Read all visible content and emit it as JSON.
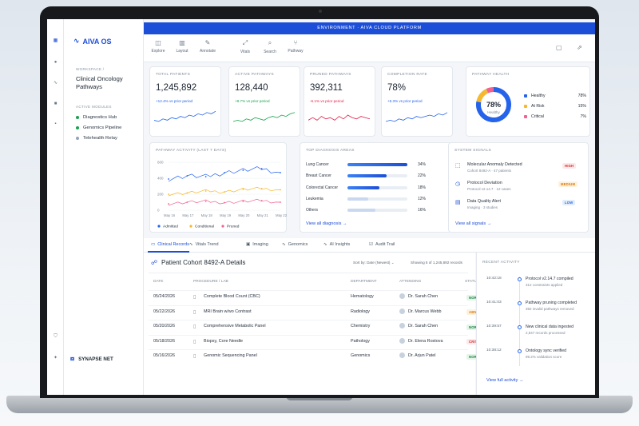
{
  "header": {
    "env": "ENVIRONMENT · AIVA CLOUD PLATFORM"
  },
  "brand": {
    "name": "AIVA OS"
  },
  "workspace": {
    "label": "WORKSPACE /",
    "name": "Clinical Oncology Pathways"
  },
  "modules": {
    "label": "ACTIVE MODULES",
    "items": [
      {
        "label": "Diagnostics Hub",
        "color": "#16a34a"
      },
      {
        "label": "Genomics Pipeline",
        "color": "#16a34a"
      },
      {
        "label": "Telehealth Relay",
        "color": "#94a3b8"
      }
    ]
  },
  "footer_brand": "SYNAPSE NET",
  "toolbar": [
    {
      "label": "Explore",
      "icon": "explore-icon",
      "glyph": "◫"
    },
    {
      "label": "Layout",
      "icon": "layout-icon",
      "glyph": "▥"
    },
    {
      "label": "Annotate",
      "icon": "annotate-icon",
      "glyph": "✎"
    },
    {
      "label": "Vitals",
      "icon": "vitals-icon",
      "glyph": "⤢"
    },
    {
      "label": "Search",
      "icon": "search-icon",
      "glyph": "⌕"
    },
    {
      "label": "Pathway",
      "icon": "pathway-icon",
      "glyph": "⑂"
    }
  ],
  "kpis": [
    {
      "title": "TOTAL PATIENTS",
      "value": "1,245,892",
      "delta": "+12.4% vs prior period",
      "color": "#2563eb"
    },
    {
      "title": "ACTIVE PATHWAYS",
      "value": "128,440",
      "delta": "+8.7% vs prior period",
      "color": "#16a34a"
    },
    {
      "title": "PRUNED PATHWAYS",
      "value": "392,311",
      "delta": "-6.1% vs prior period",
      "color": "#e11d48"
    },
    {
      "title": "COMPLETION RATE",
      "value": "78%",
      "delta": "+5.3% vs prior period",
      "color": "#2563eb"
    }
  ],
  "health": {
    "title": "PATHWAY HEALTH",
    "center_value": "78%",
    "center_label": "Healthy",
    "items": [
      {
        "label": "Healthy",
        "value": "78%",
        "pct": 78,
        "color": "#2563eb"
      },
      {
        "label": "At Risk",
        "value": "15%",
        "pct": 15,
        "color": "#f5b82e"
      },
      {
        "label": "Critical",
        "value": "7%",
        "pct": 7,
        "color": "#f06292"
      }
    ]
  },
  "activity": {
    "title": "PATHWAY ACTIVITY (LAST 7 DAYS)",
    "yticks": [
      "600",
      "400",
      "200",
      "0"
    ],
    "xticks": [
      "May 16",
      "May 17",
      "May 18",
      "May 19",
      "May 20",
      "May 21",
      "May 22"
    ],
    "legend": [
      {
        "label": "Admitted",
        "color": "#2563eb"
      },
      {
        "label": "Conditional",
        "color": "#f5b82e"
      },
      {
        "label": "Pruned",
        "color": "#f06292"
      }
    ]
  },
  "chart_data": {
    "type": "line",
    "x": [
      "May 16",
      "May 17",
      "May 18",
      "May 19",
      "May 20",
      "May 21",
      "May 22"
    ],
    "ylim": [
      0,
      600
    ],
    "series": [
      {
        "name": "Admitted",
        "values": [
          390,
          430,
          420,
          470,
          500,
          520,
          470
        ]
      },
      {
        "name": "Conditional",
        "values": [
          200,
          215,
          240,
          230,
          260,
          270,
          255
        ]
      },
      {
        "name": "Pruned",
        "values": [
          80,
          100,
          110,
          95,
          110,
          120,
          100
        ]
      }
    ]
  },
  "diagnosis": {
    "title": "TOP DIAGNOSIS AREAS",
    "items": [
      {
        "label": "Lung Cancer",
        "value": "34%",
        "pct": 34
      },
      {
        "label": "Breast Cancer",
        "value": "22%",
        "pct": 22
      },
      {
        "label": "Colorectal Cancer",
        "value": "18%",
        "pct": 18
      },
      {
        "label": "Leukemia",
        "value": "12%",
        "pct": 12
      },
      {
        "label": "Others",
        "value": "16%",
        "pct": 16
      }
    ],
    "link": "View all diagnosis  →"
  },
  "signals": {
    "title": "SYSTEM SIGNALS",
    "items": [
      {
        "title": "Molecular Anomaly Detected",
        "sub": "Cohort 8492-A · 47 patients",
        "badge": "HIGH",
        "badge_bg": "#fde8ea",
        "badge_fg": "#dc2626",
        "icon": "anomaly-icon",
        "glyph": "⬚"
      },
      {
        "title": "Protocol Deviation",
        "sub": "Protocol v2.14.7 · 12 cases",
        "badge": "MEDIUM",
        "badge_bg": "#fdf1dc",
        "badge_fg": "#d97706",
        "icon": "deviation-icon",
        "glyph": "◷"
      },
      {
        "title": "Data Quality Alert",
        "sub": "Imaging · 3 studies",
        "badge": "LOW",
        "badge_bg": "#e3eefc",
        "badge_fg": "#2563eb",
        "icon": "quality-icon",
        "glyph": "▤"
      }
    ],
    "link": "View all signals  →"
  },
  "tabs": [
    {
      "label": "Clinical Records",
      "icon": "records-icon",
      "glyph": "▭"
    },
    {
      "label": "Vitals Trend",
      "icon": "vitals-trend-icon",
      "glyph": "∿"
    },
    {
      "label": "Imaging",
      "icon": "imaging-icon",
      "glyph": "▣"
    },
    {
      "label": "Genomics",
      "icon": "genomics-icon",
      "glyph": "∿"
    },
    {
      "label": "AI Insights",
      "icon": "ai-icon",
      "glyph": "∿"
    },
    {
      "label": "Audit Trail",
      "icon": "audit-icon",
      "glyph": "☑"
    }
  ],
  "cohort": {
    "title": "Patient Cohort 8492-A Details",
    "sort": "Sort by: Date (Newest)  ⌄",
    "showing": "Showing 5 of 1,245,892 records",
    "columns": [
      "DATE",
      "PROCEDURE / LAB",
      "DEPARTMENT",
      "ATTENDING",
      "STATUS"
    ],
    "rows": [
      {
        "date": "05/24/2026",
        "proc": "Complete Blood Count (CBC)",
        "dept": "Hematology",
        "att": "Dr. Sarah Chen",
        "status": "NORMAL",
        "bg": "#e2f5e8",
        "fg": "#15803d"
      },
      {
        "date": "05/22/2026",
        "proc": "MRI Brain w/wo Contrast",
        "dept": "Radiology",
        "att": "Dr. Marcus Webb",
        "status": "ABNORMAL",
        "bg": "#fdf1dc",
        "fg": "#d97706"
      },
      {
        "date": "05/20/2026",
        "proc": "Comprehensive Metabolic Panel",
        "dept": "Chemistry",
        "att": "Dr. Sarah Chen",
        "status": "NORMAL",
        "bg": "#e2f5e8",
        "fg": "#15803d"
      },
      {
        "date": "05/18/2026",
        "proc": "Biopsy, Core Needle",
        "dept": "Pathology",
        "att": "Dr. Elena Rostova",
        "status": "CRITICAL",
        "bg": "#fde8ea",
        "fg": "#dc2626"
      },
      {
        "date": "05/16/2026",
        "proc": "Genomic Sequencing Panel",
        "dept": "Genomics",
        "att": "Dr. Arjun Patel",
        "status": "NORMAL",
        "bg": "#e2f5e8",
        "fg": "#15803d"
      }
    ]
  },
  "recent": {
    "title": "RECENT ACTIVITY",
    "items": [
      {
        "time": "10:42:18",
        "title": "Protocol v2.14.7 compiled",
        "sub": "312 constraints applied"
      },
      {
        "time": "10:41:03",
        "title": "Pathway pruning completed",
        "sub": "392 invalid pathways removed"
      },
      {
        "time": "10:39:57",
        "title": "New clinical data ingested",
        "sub": "2,847 records processed"
      },
      {
        "time": "10:38:12",
        "title": "Ontology sync verified",
        "sub": "99.2% validation score"
      }
    ],
    "link": "View full activity  →"
  }
}
